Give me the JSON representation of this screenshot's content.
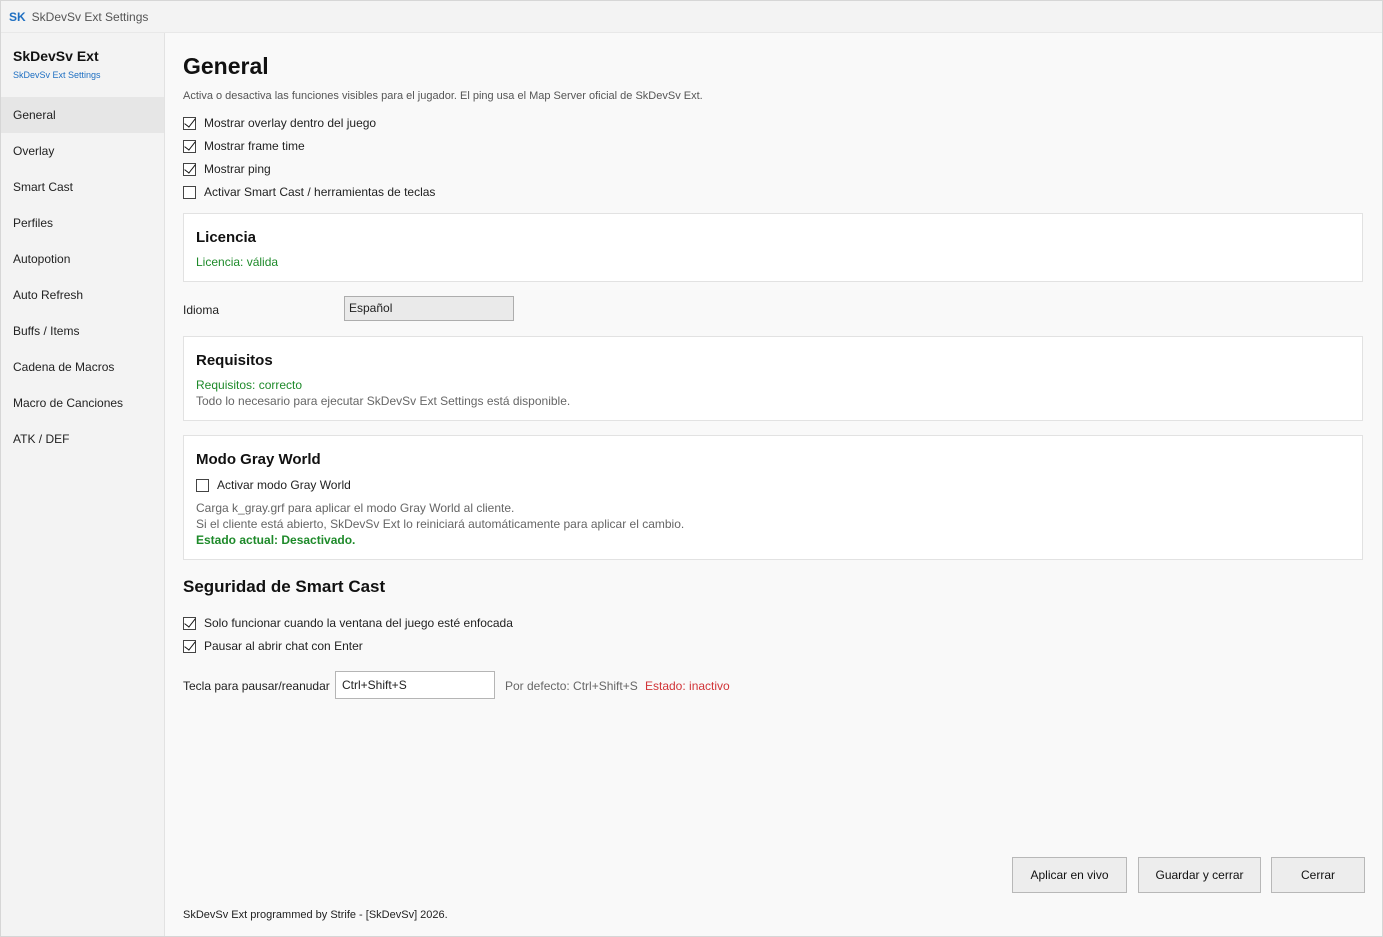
{
  "window": {
    "logo": "SK",
    "title": "SkDevSv Ext Settings"
  },
  "sidebar": {
    "brand_name": "SkDevSv Ext",
    "brand_sub": "SkDevSv Ext Settings",
    "items": [
      {
        "label": "General",
        "active": true
      },
      {
        "label": "Overlay"
      },
      {
        "label": "Smart Cast"
      },
      {
        "label": "Perfiles"
      },
      {
        "label": "Autopotion"
      },
      {
        "label": "Auto Refresh"
      },
      {
        "label": "Buffs / Items"
      },
      {
        "label": "Cadena de Macros"
      },
      {
        "label": "Macro de Canciones"
      },
      {
        "label": "ATK / DEF"
      }
    ]
  },
  "main": {
    "title": "General",
    "description": "Activa o desactiva las funciones visibles para el jugador. El ping usa el Map Server oficial de SkDevSv Ext.",
    "options": [
      {
        "label": "Mostrar overlay dentro del juego",
        "checked": true
      },
      {
        "label": "Mostrar frame time",
        "checked": true
      },
      {
        "label": "Mostrar ping",
        "checked": true
      },
      {
        "label": "Activar Smart Cast / herramientas de teclas",
        "checked": false
      }
    ],
    "license": {
      "title": "Licencia",
      "status": "Licencia: válida"
    },
    "language": {
      "label": "Idioma",
      "value": "Español"
    },
    "requirements": {
      "title": "Requisitos",
      "status": "Requisitos: correcto",
      "detail": "Todo lo necesario para ejecutar SkDevSv Ext Settings está disponible."
    },
    "gray_world": {
      "title": "Modo Gray World",
      "toggle_label": "Activar modo Gray World",
      "checked": false,
      "line1": "Carga k_gray.grf para aplicar el modo Gray World al cliente.",
      "line2": "Si el cliente está abierto, SkDevSv Ext lo reiniciará automáticamente para aplicar el cambio.",
      "state": "Estado actual: Desactivado."
    },
    "smart_cast_security": {
      "title": "Seguridad de Smart Cast",
      "options": [
        {
          "label": "Solo funcionar cuando la ventana del juego esté enfocada",
          "checked": true
        },
        {
          "label": "Pausar al abrir chat con Enter",
          "checked": true
        }
      ],
      "hotkey_label": "Tecla para pausar/reanudar",
      "hotkey_value": "Ctrl+Shift+S",
      "default_hint": "Por defecto: Ctrl+Shift+S",
      "state": "Estado: inactivo"
    },
    "footer": "SkDevSv Ext programmed by Strife - [SkDevSv] 2026."
  },
  "buttons": {
    "apply": "Aplicar en vivo",
    "save": "Guardar y cerrar",
    "close": "Cerrar"
  },
  "colors": {
    "accent": "#1e6fc2",
    "success": "#1e8a2a",
    "error": "#d13438"
  }
}
